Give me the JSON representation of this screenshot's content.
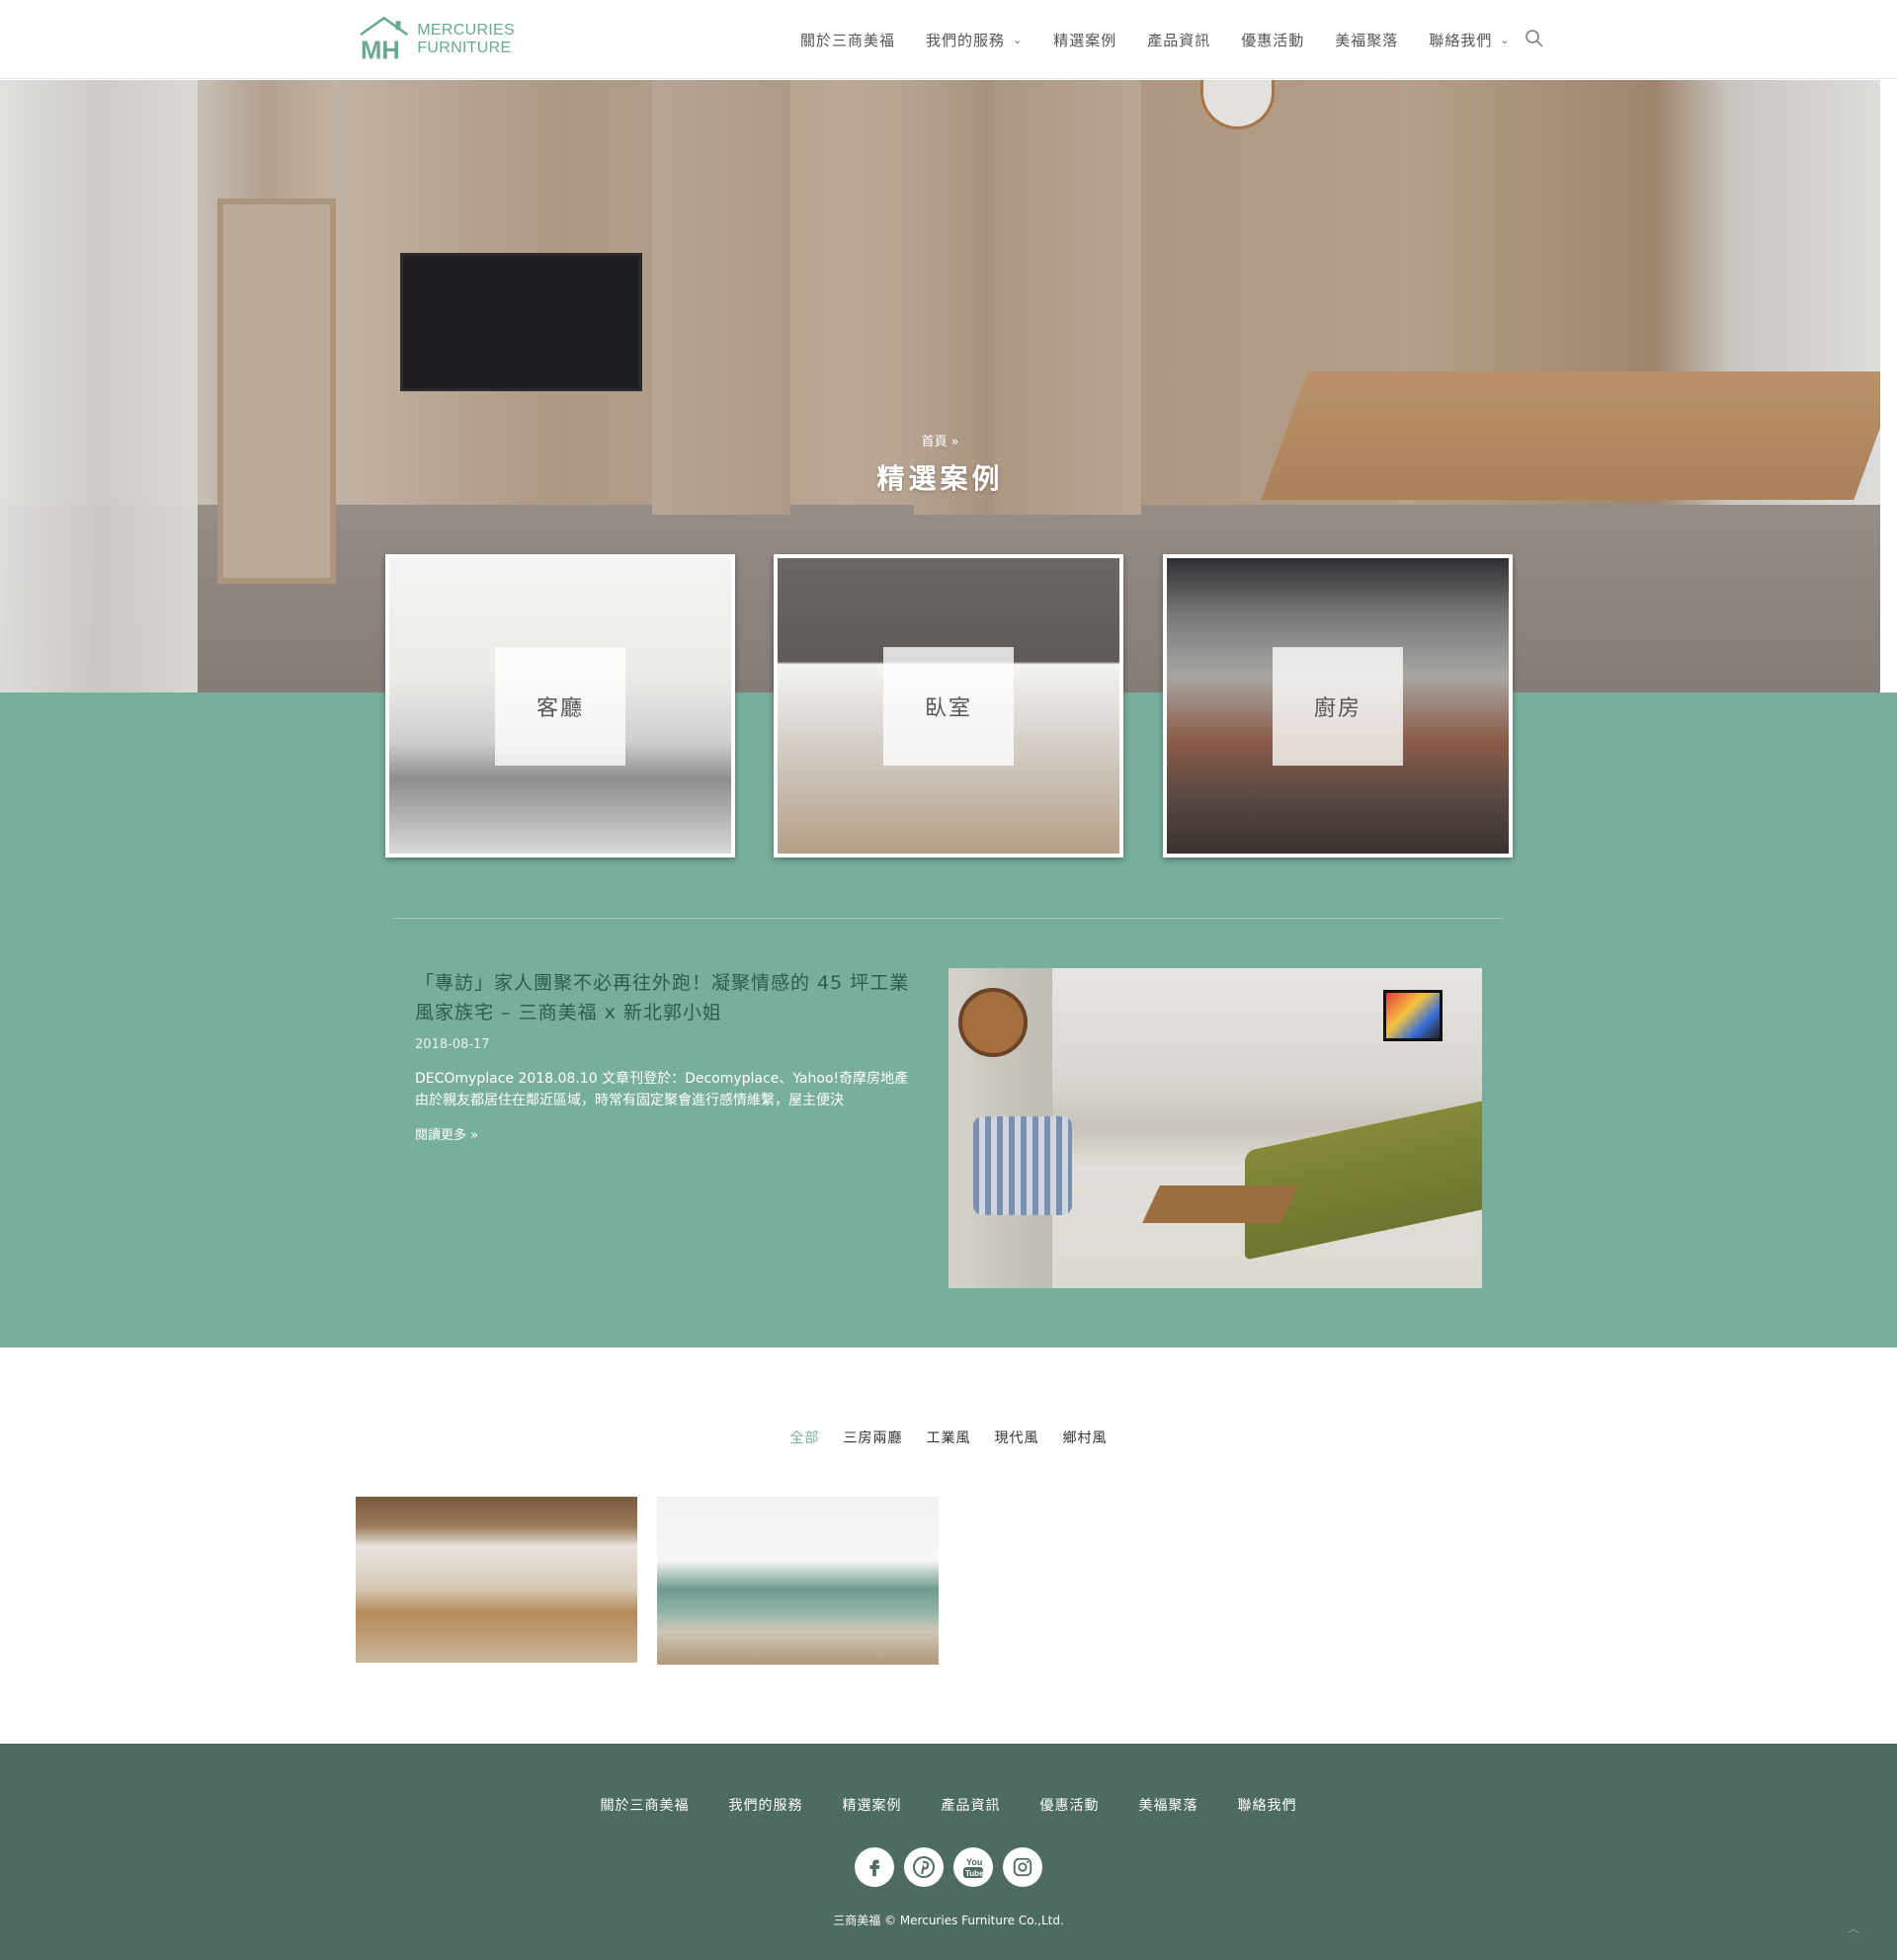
{
  "brand": {
    "name_line1": "MERCURIES",
    "name_line2": "FURNITURE",
    "mark": "MH",
    "color": "#6aa894"
  },
  "nav": {
    "items": [
      {
        "label": "關於三商美福",
        "has_dropdown": false
      },
      {
        "label": "我們的服務",
        "has_dropdown": true
      },
      {
        "label": "精選案例",
        "has_dropdown": false
      },
      {
        "label": "產品資訊",
        "has_dropdown": false
      },
      {
        "label": "優惠活動",
        "has_dropdown": false
      },
      {
        "label": "美福聚落",
        "has_dropdown": false
      },
      {
        "label": "聯絡我們",
        "has_dropdown": true
      }
    ],
    "search_icon": "search-icon"
  },
  "hero": {
    "breadcrumb": "首頁 »",
    "title": "精選案例"
  },
  "categories": [
    {
      "label": "客廳"
    },
    {
      "label": "臥室"
    },
    {
      "label": "廚房"
    }
  ],
  "featured_post": {
    "title": "「專訪」家人團聚不必再往外跑！凝聚情感的 45 坪工業風家族宅 – 三商美福 x 新北郭小姐",
    "date": "2018-08-17",
    "excerpt": "DECOmyplace 2018.08.10 文章刊登於：Decomyplace、Yahoo!奇摩房地產 由於親友都居住在鄰近區域，時常有固定聚會進行感情維繫，屋主便決",
    "read_more": "閱讀更多 »"
  },
  "filters": [
    {
      "label": "全部",
      "active": true
    },
    {
      "label": "三房兩廳",
      "active": false
    },
    {
      "label": "工業風",
      "active": false
    },
    {
      "label": "現代風",
      "active": false
    },
    {
      "label": "鄉村風",
      "active": false
    }
  ],
  "footer": {
    "nav": [
      "關於三商美福",
      "我們的服務",
      "精選案例",
      "產品資訊",
      "優惠活動",
      "美福聚落",
      "聯絡我們"
    ],
    "socials": [
      "facebook-icon",
      "pinterest-icon",
      "youtube-icon",
      "instagram-icon"
    ],
    "copyright": "三商美福 © Mercuries Furniture Co.,Ltd."
  },
  "colors": {
    "accent": "#78ae9c",
    "footer_bg": "#4e6b62",
    "title_text": "#2f5b4f"
  }
}
